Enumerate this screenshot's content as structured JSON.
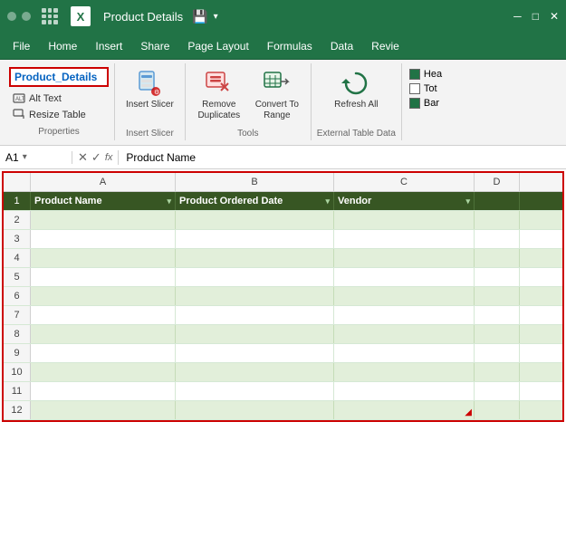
{
  "titlebar": {
    "app_name": "Product Details",
    "logo": "X"
  },
  "menubar": {
    "items": [
      "File",
      "Home",
      "Insert",
      "Share",
      "Page Layout",
      "Formulas",
      "Data",
      "Revie"
    ]
  },
  "ribbon": {
    "properties_group_label": "Properties",
    "table_name": "Product_Details",
    "alt_text_label": "Alt Text",
    "resize_table_label": "Resize Table",
    "insert_slicer_label": "Insert Slicer",
    "insert_slicer_group": "Insert Slicer",
    "remove_duplicates_label": "Remove Duplicates",
    "convert_to_label": "Convert To Range",
    "tools_group": "Tools",
    "refresh_all_label": "Refresh All",
    "external_table_data_group": "External Table Data",
    "checkboxes": [
      {
        "label": "Hea",
        "checked": true
      },
      {
        "label": "Tot",
        "checked": false
      },
      {
        "label": "Bar",
        "checked": true
      }
    ]
  },
  "formulabar": {
    "cell_ref": "A1",
    "formula_content": "Product Name"
  },
  "spreadsheet": {
    "columns": [
      "A",
      "B",
      "C",
      "D"
    ],
    "headers": [
      {
        "label": "Product Name",
        "width": "col-a"
      },
      {
        "label": "Product Ordered Date",
        "width": "col-b"
      },
      {
        "label": "Vendor",
        "width": "col-c"
      }
    ],
    "rows": [
      1,
      2,
      3,
      4,
      5,
      6,
      7,
      8,
      9,
      10,
      11,
      12
    ]
  }
}
